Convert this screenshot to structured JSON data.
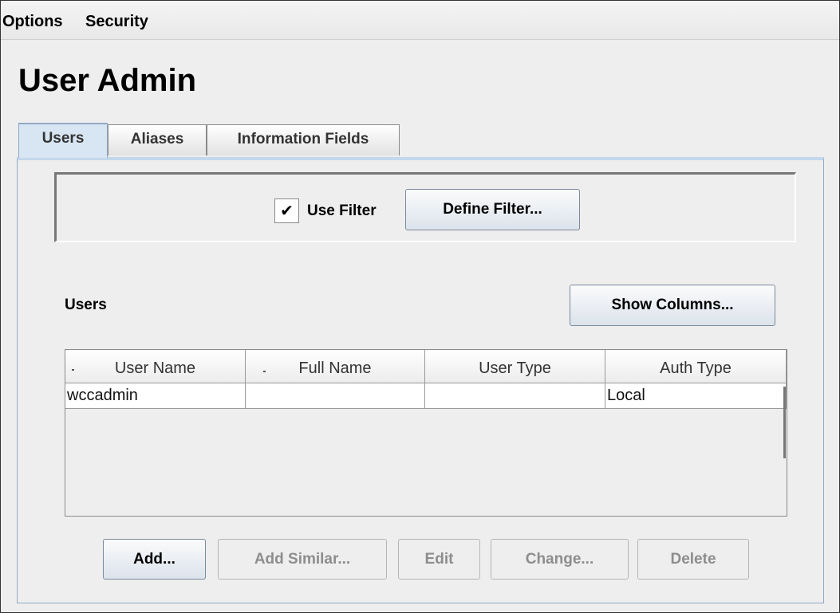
{
  "menubar": {
    "items": [
      "Options",
      "Security"
    ]
  },
  "page_title": "User Admin",
  "tabs": [
    {
      "label": "Users",
      "active": true
    },
    {
      "label": "Aliases",
      "active": false
    },
    {
      "label": "Information Fields",
      "active": false
    }
  ],
  "filter": {
    "use_filter_label": "Use Filter",
    "use_filter_checked": true,
    "define_button": "Define Filter..."
  },
  "users_section": {
    "title": "Users",
    "show_columns_button": "Show Columns...",
    "columns": [
      "User Name",
      "Full Name",
      "User Type",
      "Auth Type"
    ],
    "rows": [
      {
        "user_name": "wccadmin",
        "full_name": "",
        "user_type": "",
        "auth_type": "Local"
      }
    ]
  },
  "actions": {
    "add": "Add...",
    "add_similar": "Add Similar...",
    "edit": "Edit",
    "change": "Change...",
    "delete": "Delete"
  },
  "colors": {
    "tab_active": "#d8e6f3",
    "button_gradient_end": "#dce3ec",
    "disabled_text": "#8d8d8d"
  }
}
